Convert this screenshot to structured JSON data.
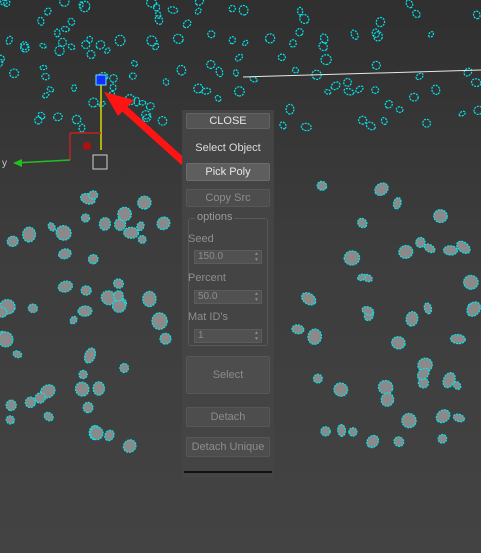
{
  "viewport": {
    "accent_color": "#00e8f0",
    "arrow_color": "#ff1414",
    "gizmo_axis_labels": {
      "y": "y"
    }
  },
  "panel": {
    "close_label": "CLOSE",
    "select_object_label": "Select Object",
    "pick_poly_label": "Pick Poly",
    "copy_src_label": "Copy Src",
    "options_label": "options",
    "seed_label": "Seed",
    "seed_value": "150.0",
    "percent_label": "Percent",
    "percent_value": "50.0",
    "mat_ids_label": "Mat ID's",
    "mat_ids_value": "1",
    "select_label": "Select",
    "detach_label": "Detach",
    "detach_unique_label": "Detach Unique"
  }
}
